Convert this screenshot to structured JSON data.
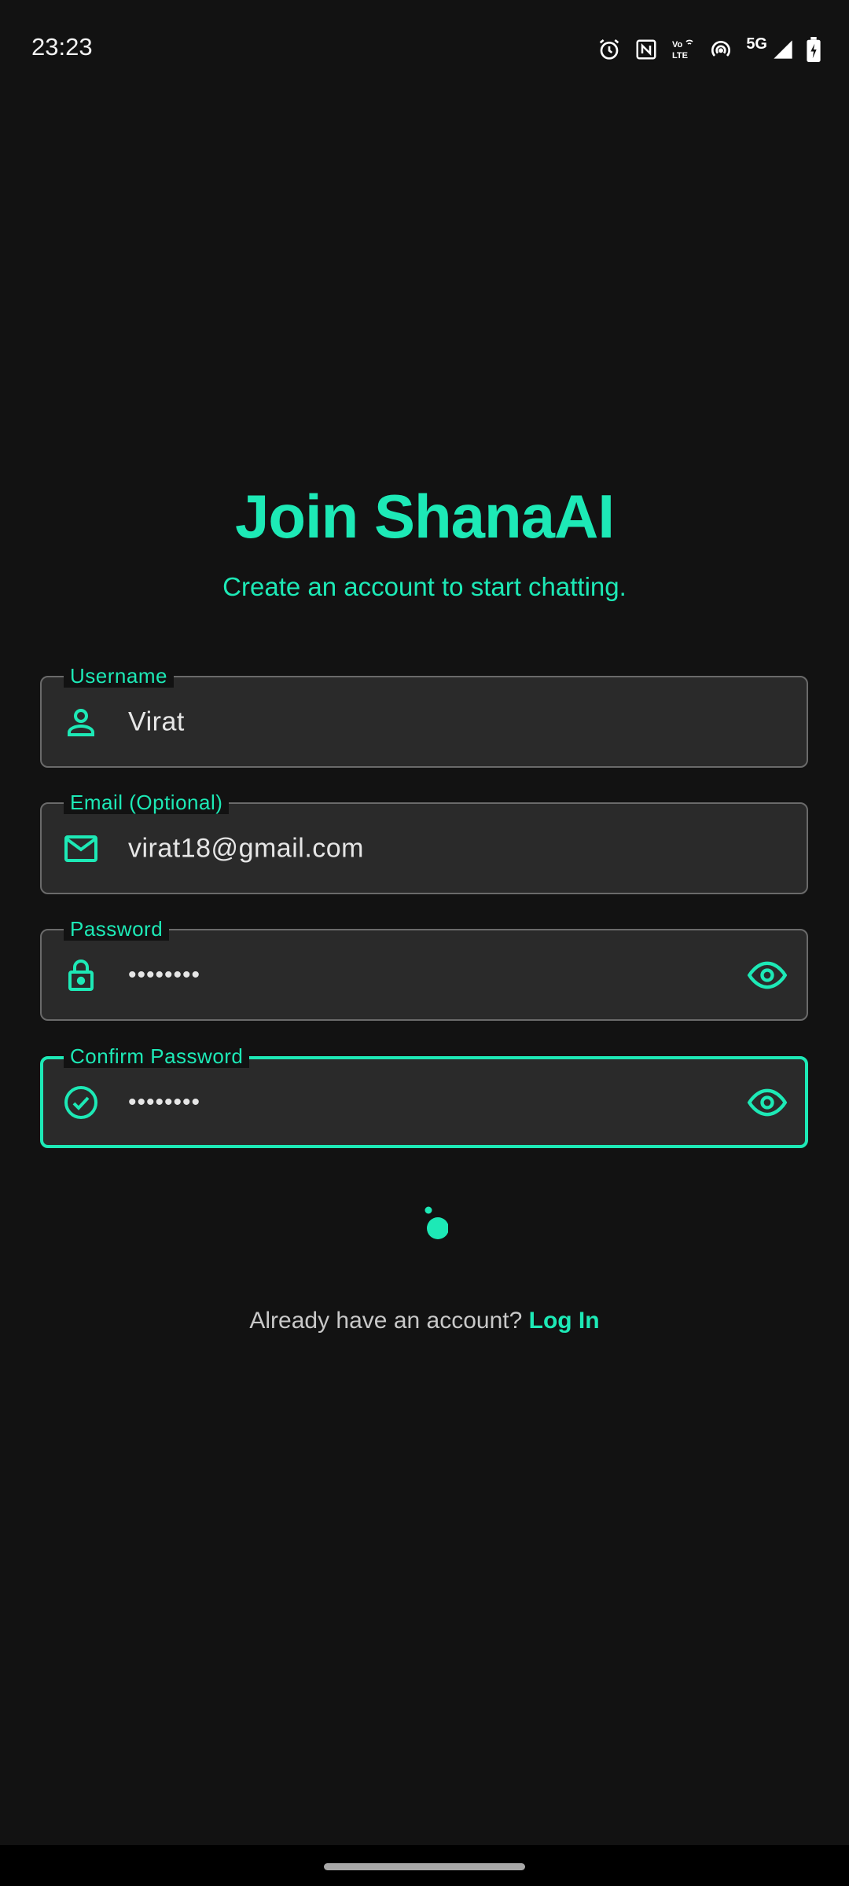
{
  "status_bar": {
    "time": "23:23",
    "network_label": "5G",
    "volte_label": "Vo LTE"
  },
  "header": {
    "title": "Join ShanaAI",
    "subtitle": "Create an account to start chatting."
  },
  "form": {
    "username": {
      "label": "Username",
      "value": "Virat",
      "icon": "person-icon"
    },
    "email": {
      "label": "Email (Optional)",
      "value": "virat18@gmail.com",
      "icon": "mail-icon"
    },
    "password": {
      "label": "Password",
      "value": "••••••••",
      "icon": "lock-icon",
      "toggle_icon": "eye-icon"
    },
    "confirm_password": {
      "label": "Confirm Password",
      "value": "••••••••",
      "icon": "check-circle-icon",
      "toggle_icon": "eye-icon",
      "focused": true
    }
  },
  "footer": {
    "prompt": "Already have an account?",
    "link": "Log In"
  },
  "colors": {
    "accent": "#1de9b6",
    "background": "#121212",
    "field_background": "#2a2a2a",
    "field_border": "#6a6a6a"
  }
}
